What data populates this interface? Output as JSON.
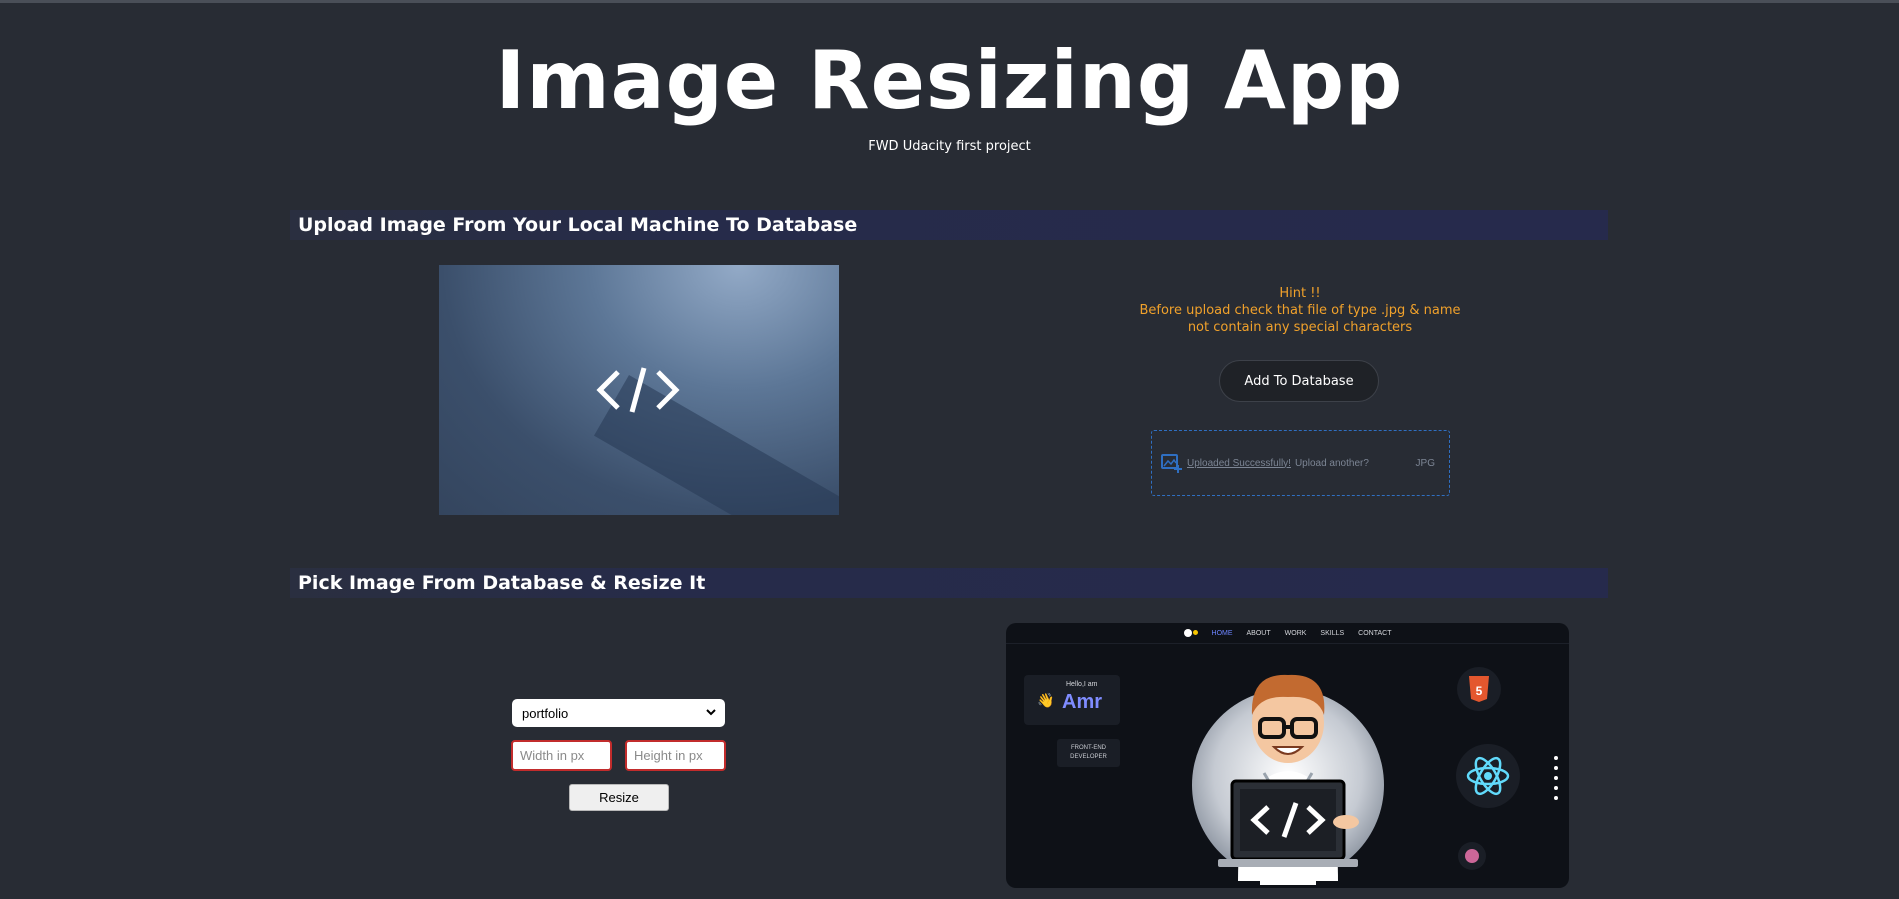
{
  "header": {
    "title": "Image Resizing App",
    "subtitle": "FWD Udacity first project"
  },
  "upload_section": {
    "heading": "Upload Image From Your Local Machine To Database",
    "hint_title": "Hint !!",
    "hint_text": "Before upload check that file of type .jpg & name not contain any special characters",
    "add_button_label": "Add To Database",
    "dropzone": {
      "success_text": "Uploaded Successfully!",
      "another_text": "Upload another?",
      "extension": "JPG"
    }
  },
  "resize_section": {
    "heading": "Pick Image From Database & Resize It",
    "selected_image": "portfolio",
    "width_placeholder": "Width in px",
    "height_placeholder": "Height in px",
    "resize_button_label": "Resize"
  },
  "result_preview": {
    "nav": [
      "HOME",
      "ABOUT",
      "WORK",
      "SKILLS",
      "CONTACT"
    ],
    "hello": "Hello,I am",
    "name": "Amr",
    "role_line1": "FRONT-END",
    "role_line2": "DEVELOPER"
  },
  "colors": {
    "background": "#282c34",
    "hint": "#f0a12b",
    "section_bar": "#262a4c",
    "dropzone_border": "#2f6fc2",
    "input_border": "#c22c2c"
  }
}
